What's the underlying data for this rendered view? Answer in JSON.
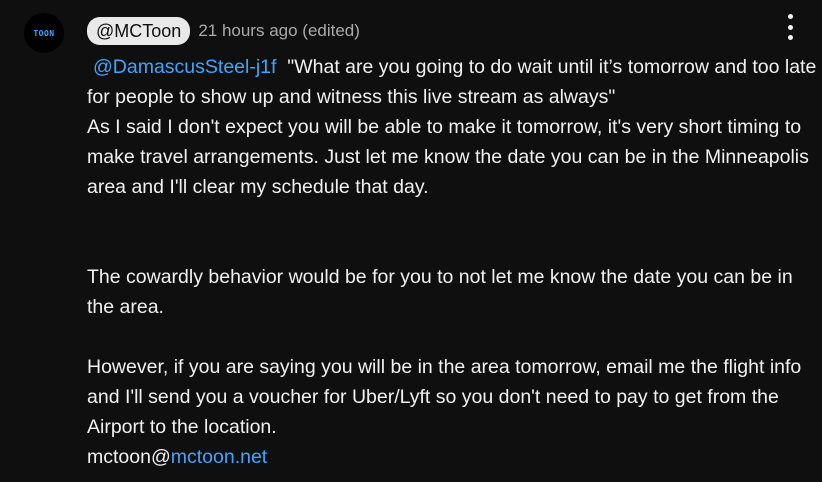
{
  "avatar": {
    "text": "TOON"
  },
  "comment": {
    "author": "@MCToon",
    "timestamp": "21 hours ago (edited)",
    "mention": "@DamascusSteel-j1f",
    "quote": "\"What are you going to do wait until it’s tomorrow and too late for people to show up and witness this live stream as always\"",
    "para1": "As I said I don't expect you will be able to make it tomorrow, it's very short timing to make travel arrangements.  Just let me know the date you can be in the Minneapolis area and I'll clear my schedule that day.",
    "para2": "The cowardly behavior would be for you to not let me know the date you can be in the area.",
    "para3": "However, if you are saying you will be in the area tomorrow, email me the flight info and I'll send you a voucher for Uber/Lyft so you don't need to pay to get from the Airport to the location.",
    "email_prefix": "mctoon@",
    "email_domain": "mctoon.net"
  },
  "colors": {
    "background": "#0f0f0f",
    "text": "#f1f1f1",
    "link": "#3ea6ff",
    "meta": "#aaaaaa"
  },
  "icons": {
    "menu": "vertical-ellipsis-icon"
  }
}
